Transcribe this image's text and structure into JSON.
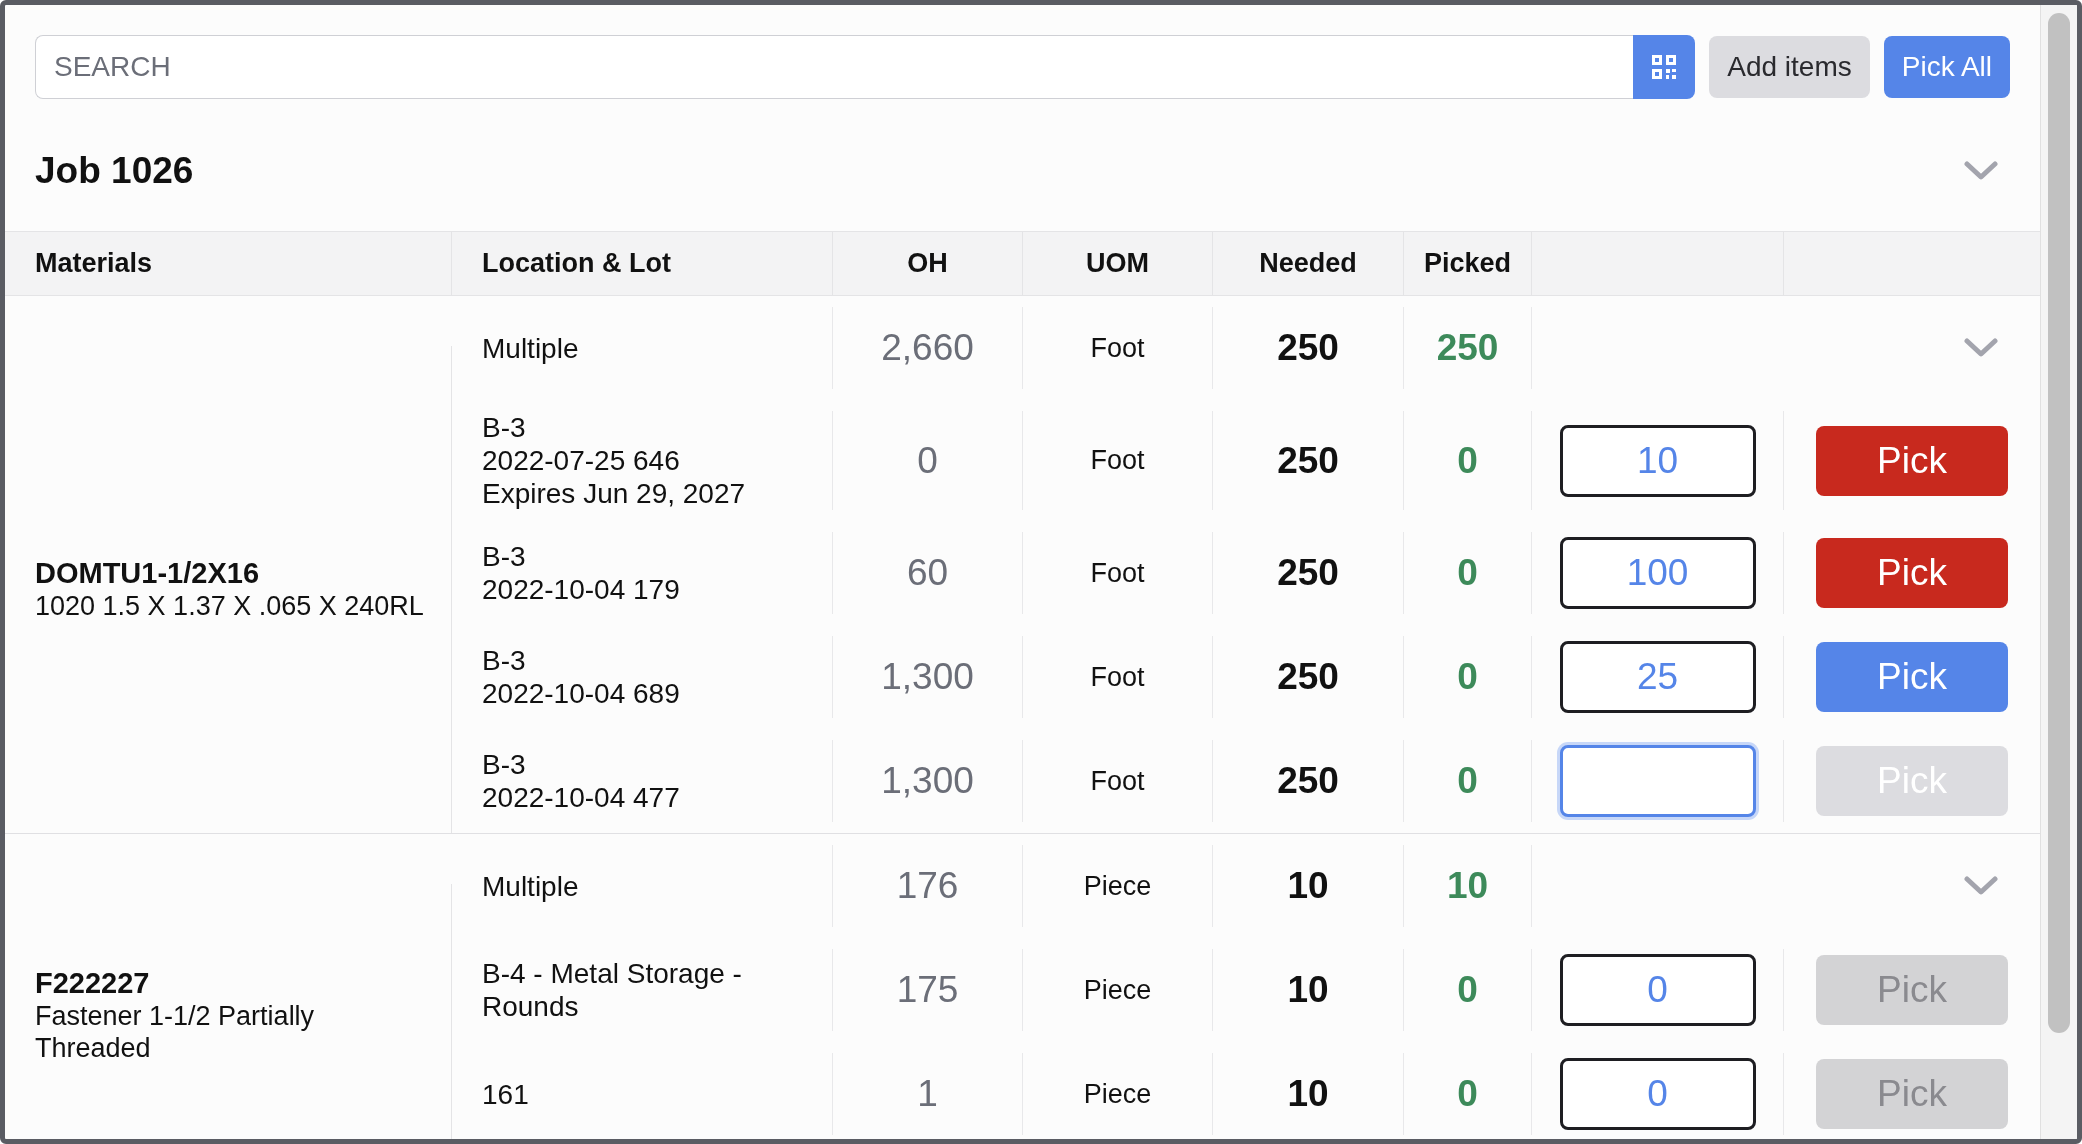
{
  "search": {
    "placeholder": "SEARCH"
  },
  "buttons": [
    {
      "label": "Add items",
      "kind": "secondary"
    },
    {
      "label": "Pick All",
      "kind": "primary"
    }
  ],
  "job": {
    "title": "Job 1026"
  },
  "columns": [
    "Materials",
    "Location & Lot",
    "OH",
    "UOM",
    "Needed",
    "Picked"
  ],
  "materials": [
    {
      "code": "DOMTU1-1/2X16",
      "description": "1020 1.5 X 1.37 X .065 X 240RL",
      "summary": {
        "location": [
          "Multiple"
        ],
        "oh": "2,660",
        "uom": "Foot",
        "needed": "250",
        "picked": "250"
      },
      "lots": [
        {
          "location": [
            "B-3",
            "2022-07-25 646",
            "Expires Jun 29, 2027"
          ],
          "oh": "0",
          "uom": "Foot",
          "needed": "250",
          "picked": "0",
          "quantity": "10",
          "focused": false,
          "pick": {
            "label": "Pick",
            "kind": "over"
          }
        },
        {
          "location": [
            "B-3",
            "2022-10-04 179"
          ],
          "oh": "60",
          "uom": "Foot",
          "needed": "250",
          "picked": "0",
          "quantity": "100",
          "focused": false,
          "pick": {
            "label": "Pick",
            "kind": "over"
          }
        },
        {
          "location": [
            "B-3",
            "2022-10-04 689"
          ],
          "oh": "1,300",
          "uom": "Foot",
          "needed": "250",
          "picked": "0",
          "quantity": "25",
          "focused": false,
          "pick": {
            "label": "Pick",
            "kind": "ready"
          }
        },
        {
          "location": [
            "B-3",
            "2022-10-04 477"
          ],
          "oh": "1,300",
          "uom": "Foot",
          "needed": "250",
          "picked": "0",
          "focused": true,
          "pick": {
            "label": "Pick",
            "kind": "empty"
          }
        }
      ]
    },
    {
      "code": "F222227",
      "description": "Fastener 1-1/2 Partially Threaded",
      "summary": {
        "location": [
          "Multiple"
        ],
        "oh": "176",
        "uom": "Piece",
        "needed": "10",
        "picked": "10"
      },
      "lots": [
        {
          "location": [
            "B-4 - Metal Storage -",
            "Rounds"
          ],
          "oh": "175",
          "uom": "Piece",
          "needed": "10",
          "picked": "0",
          "quantity": "0",
          "focused": false,
          "pick": {
            "label": "Pick",
            "kind": "disabled"
          }
        },
        {
          "location": [
            "161"
          ],
          "oh": "1",
          "uom": "Piece",
          "needed": "10",
          "picked": "0",
          "quantity": "0",
          "focused": false,
          "pick": {
            "label": "Pick",
            "kind": "disabled"
          }
        }
      ]
    }
  ]
}
